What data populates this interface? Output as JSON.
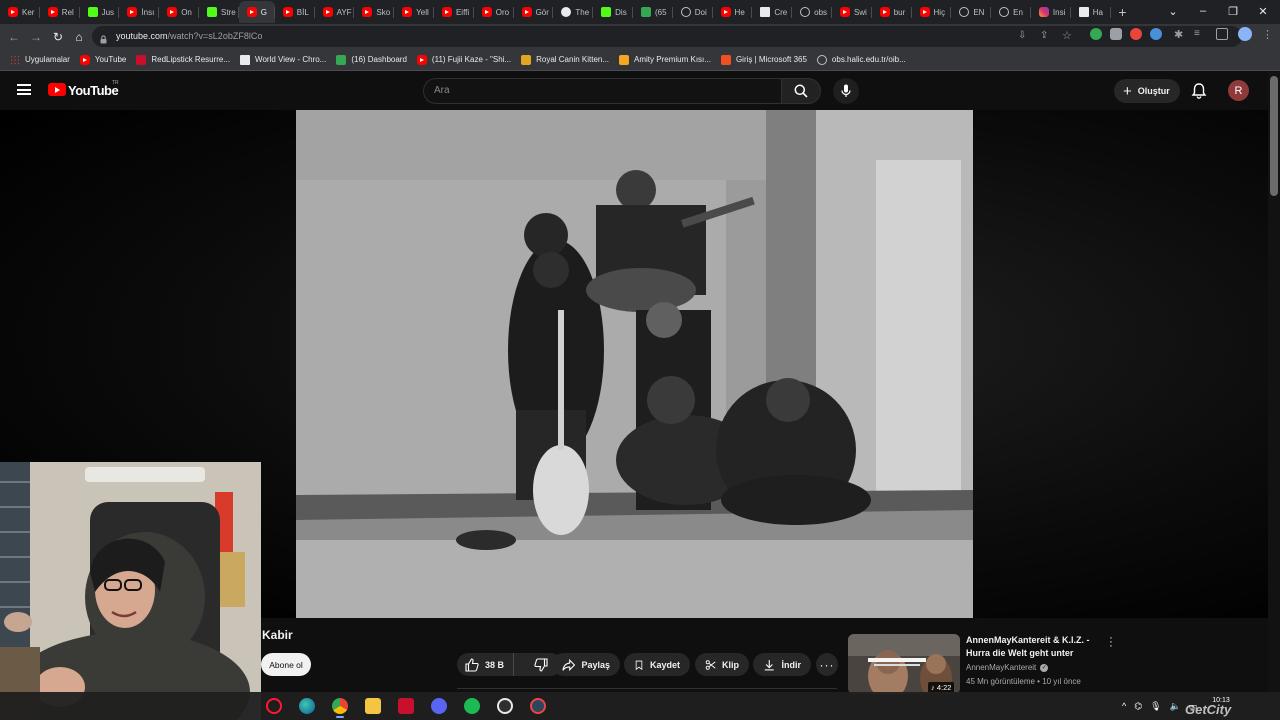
{
  "browser": {
    "tabs": [
      {
        "label": "Ker",
        "icon": "yt"
      },
      {
        "label": "Rel",
        "icon": "yt"
      },
      {
        "label": "Jus",
        "icon": "kick"
      },
      {
        "label": "İnsı",
        "icon": "yt"
      },
      {
        "label": "On",
        "icon": "yt"
      },
      {
        "label": "Stre",
        "icon": "kick"
      },
      {
        "label": "G",
        "icon": "yt",
        "active": true
      },
      {
        "label": "BİL",
        "icon": "yt"
      },
      {
        "label": "AYF",
        "icon": "yt"
      },
      {
        "label": "Sko",
        "icon": "yt"
      },
      {
        "label": "Yell",
        "icon": "yt"
      },
      {
        "label": "Eiffi",
        "icon": "yt"
      },
      {
        "label": "Oro",
        "icon": "yt"
      },
      {
        "label": "Gör",
        "icon": "yt"
      },
      {
        "label": "The",
        "icon": "dark"
      },
      {
        "label": "Dis",
        "icon": "kick"
      },
      {
        "label": "(65",
        "icon": "grn"
      },
      {
        "label": "Doi",
        "icon": "globe"
      },
      {
        "label": "He",
        "icon": "yt"
      },
      {
        "label": "Cre",
        "icon": "doc"
      },
      {
        "label": "obs",
        "icon": "globe"
      },
      {
        "label": "Swi",
        "icon": "yt"
      },
      {
        "label": "bur",
        "icon": "yt"
      },
      {
        "label": "Hiç",
        "icon": "yt"
      },
      {
        "label": "EN",
        "icon": "globe"
      },
      {
        "label": "En",
        "icon": "globe"
      },
      {
        "label": "Insi",
        "icon": "ig"
      },
      {
        "label": "Ha",
        "icon": "doc"
      }
    ],
    "new_tab": "+",
    "url_host": "youtube.com",
    "url_path": "/watch?v=sL2obZF8lCo",
    "bookmarks": [
      {
        "label": "Uygulamalar",
        "icon": "apps-grid"
      },
      {
        "label": "YouTube",
        "icon": "yt"
      },
      {
        "label": "RedLipstick Resurre...",
        "icon": "redlipstick"
      },
      {
        "label": "World View - Chro...",
        "icon": "doc"
      },
      {
        "label": "(16) Dashboard",
        "icon": "grn"
      },
      {
        "label": "(11) Fujii Kaze - \"Shi...",
        "icon": "yt"
      },
      {
        "label": "Royal Canin Kitten...",
        "icon": "royalcanin"
      },
      {
        "label": "Amity Premium Kısı...",
        "icon": "amity"
      },
      {
        "label": "Giriş | Microsoft 365",
        "icon": "microsoft"
      },
      {
        "label": "obs.halic.edu.tr/oib...",
        "icon": "globe"
      }
    ]
  },
  "youtube": {
    "wordmark": "YouTube",
    "country_code": "TR",
    "search_placeholder": "Ara",
    "create_label": "Oluştur",
    "avatar_letter": "R"
  },
  "video": {
    "title": "Kabir",
    "subscribe_label": "Abone ol",
    "likes": "38 B",
    "share_label": "Paylaş",
    "save_label": "Kaydet",
    "clip_label": "Klip",
    "download_label": "İndir"
  },
  "recommendation": {
    "title": "AnnenMayKantereit & K.I.Z. - Hurra die Welt geht unter",
    "channel": "AnnenMayKantereit",
    "views": "45 Mn görüntüleme",
    "age": "10 yıl önce",
    "duration": "4:22"
  },
  "taskbar": {
    "apps": [
      "opera-icon",
      "edge-icon",
      "chrome-icon",
      "files-icon",
      "voice-mod-icon",
      "discord-icon",
      "spotify-icon",
      "obs-icon",
      "steam-icon"
    ],
    "time": "10:13",
    "date": "",
    "watermark": "GetCity"
  },
  "colors": {
    "yt_red": "#ff0000",
    "bg": "#0f0f0f",
    "pill": "#272727",
    "chrome_bar": "#35363a"
  }
}
